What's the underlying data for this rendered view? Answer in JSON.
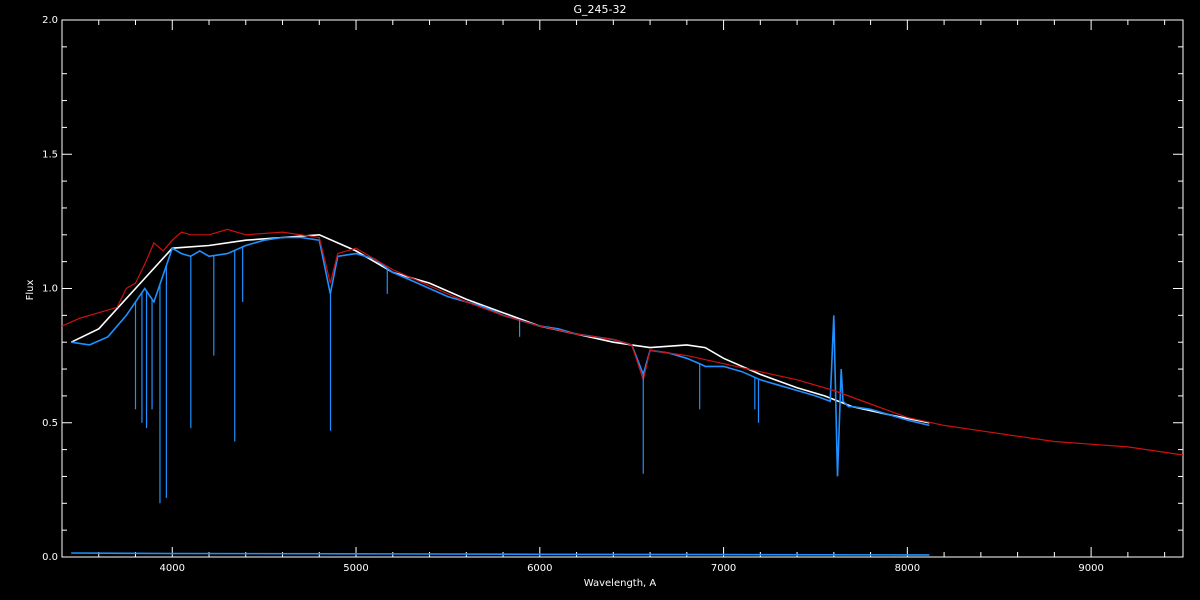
{
  "chart_data": {
    "type": "line",
    "title": "G_245-32",
    "xlabel": "Wavelength, A",
    "ylabel": "Flux",
    "xlim": [
      3400,
      9500
    ],
    "ylim": [
      0.0,
      2.0
    ],
    "xticks": [
      4000,
      5000,
      6000,
      7000,
      8000,
      9000
    ],
    "yticks": [
      "0.0",
      "0.5",
      "1.0",
      "1.5",
      "2.0"
    ],
    "grid": false,
    "colors": {
      "background": "#000000",
      "axes": "#ffffff",
      "white_series": "#ffffff",
      "blue_series": "#1e90ff",
      "red_series": "#cc1111"
    },
    "series": [
      {
        "color_key": "white_series",
        "x": [
          3450,
          3600,
          3800,
          4000,
          4200,
          4400,
          4600,
          4800,
          5000,
          5200,
          5400,
          5600,
          5800,
          6000,
          6200,
          6400,
          6600,
          6800,
          6900,
          7000,
          7200,
          7400,
          7550,
          7700,
          7900,
          8120
        ],
        "y": [
          0.8,
          0.85,
          1.0,
          1.15,
          1.16,
          1.18,
          1.19,
          1.2,
          1.14,
          1.06,
          1.02,
          0.96,
          0.91,
          0.86,
          0.83,
          0.8,
          0.78,
          0.79,
          0.78,
          0.74,
          0.68,
          0.63,
          0.6,
          0.56,
          0.53,
          0.5
        ]
      },
      {
        "color_key": "blue_series",
        "x": [
          3450,
          3550,
          3650,
          3750,
          3800,
          3850,
          3900,
          3950,
          4000,
          4050,
          4100,
          4150,
          4200,
          4300,
          4400,
          4500,
          4600,
          4700,
          4800,
          4860,
          4900,
          5000,
          5100,
          5200,
          5300,
          5400,
          5500,
          5600,
          5700,
          5800,
          5900,
          6000,
          6100,
          6200,
          6300,
          6400,
          6500,
          6563,
          6600,
          6700,
          6800,
          6870,
          6900,
          7000,
          7100,
          7200,
          7300,
          7400,
          7500,
          7580,
          7600,
          7620,
          7640,
          7650,
          7680,
          7700,
          7800,
          7900,
          8000,
          8120
        ],
        "y": [
          0.8,
          0.79,
          0.82,
          0.9,
          0.95,
          1.0,
          0.95,
          1.05,
          1.15,
          1.13,
          1.12,
          1.14,
          1.12,
          1.13,
          1.16,
          1.18,
          1.19,
          1.19,
          1.18,
          0.98,
          1.12,
          1.13,
          1.11,
          1.06,
          1.03,
          1.0,
          0.97,
          0.95,
          0.93,
          0.9,
          0.88,
          0.86,
          0.85,
          0.83,
          0.82,
          0.81,
          0.79,
          0.68,
          0.77,
          0.76,
          0.74,
          0.72,
          0.71,
          0.71,
          0.69,
          0.66,
          0.64,
          0.62,
          0.6,
          0.58,
          0.9,
          0.3,
          0.7,
          0.58,
          0.56,
          0.56,
          0.55,
          0.53,
          0.51,
          0.49
        ]
      },
      {
        "color_key": "red_series",
        "x": [
          3400,
          3500,
          3600,
          3700,
          3750,
          3800,
          3850,
          3900,
          3950,
          4000,
          4050,
          4100,
          4200,
          4300,
          4400,
          4600,
          4800,
          4860,
          4900,
          5000,
          5200,
          5400,
          5600,
          5800,
          6000,
          6200,
          6400,
          6500,
          6563,
          6600,
          6800,
          7000,
          7200,
          7400,
          7600,
          7800,
          8000,
          8200,
          8400,
          8600,
          8800,
          9000,
          9200,
          9500
        ],
        "y": [
          0.86,
          0.89,
          0.91,
          0.93,
          1.0,
          1.02,
          1.09,
          1.17,
          1.14,
          1.18,
          1.21,
          1.2,
          1.2,
          1.22,
          1.2,
          1.21,
          1.19,
          1.02,
          1.13,
          1.15,
          1.07,
          1.01,
          0.95,
          0.9,
          0.86,
          0.83,
          0.81,
          0.79,
          0.66,
          0.77,
          0.75,
          0.72,
          0.69,
          0.66,
          0.62,
          0.57,
          0.52,
          0.49,
          0.47,
          0.45,
          0.43,
          0.42,
          0.41,
          0.38
        ]
      },
      {
        "color_key": "blue_series",
        "x": [
          3450,
          4000,
          5000,
          6000,
          7000,
          8000,
          8120
        ],
        "y": [
          0.015,
          0.013,
          0.012,
          0.01,
          0.009,
          0.008,
          0.008
        ]
      }
    ],
    "absorption_lines": {
      "color_key": "blue_series",
      "lines": [
        {
          "x": 3800,
          "depth_to": 0.55
        },
        {
          "x": 3835,
          "depth_to": 0.5
        },
        {
          "x": 3860,
          "depth_to": 0.48
        },
        {
          "x": 3890,
          "depth_to": 0.55
        },
        {
          "x": 3933,
          "depth_to": 0.2
        },
        {
          "x": 3968,
          "depth_to": 0.22
        },
        {
          "x": 4101,
          "depth_to": 0.48
        },
        {
          "x": 4226,
          "depth_to": 0.75
        },
        {
          "x": 4340,
          "depth_to": 0.43
        },
        {
          "x": 4383,
          "depth_to": 0.95
        },
        {
          "x": 4861,
          "depth_to": 0.47
        },
        {
          "x": 5170,
          "depth_to": 0.98
        },
        {
          "x": 5890,
          "depth_to": 0.82
        },
        {
          "x": 6563,
          "depth_to": 0.31
        },
        {
          "x": 6870,
          "depth_to": 0.55
        },
        {
          "x": 7170,
          "depth_to": 0.55
        },
        {
          "x": 7190,
          "depth_to": 0.5
        }
      ]
    }
  }
}
